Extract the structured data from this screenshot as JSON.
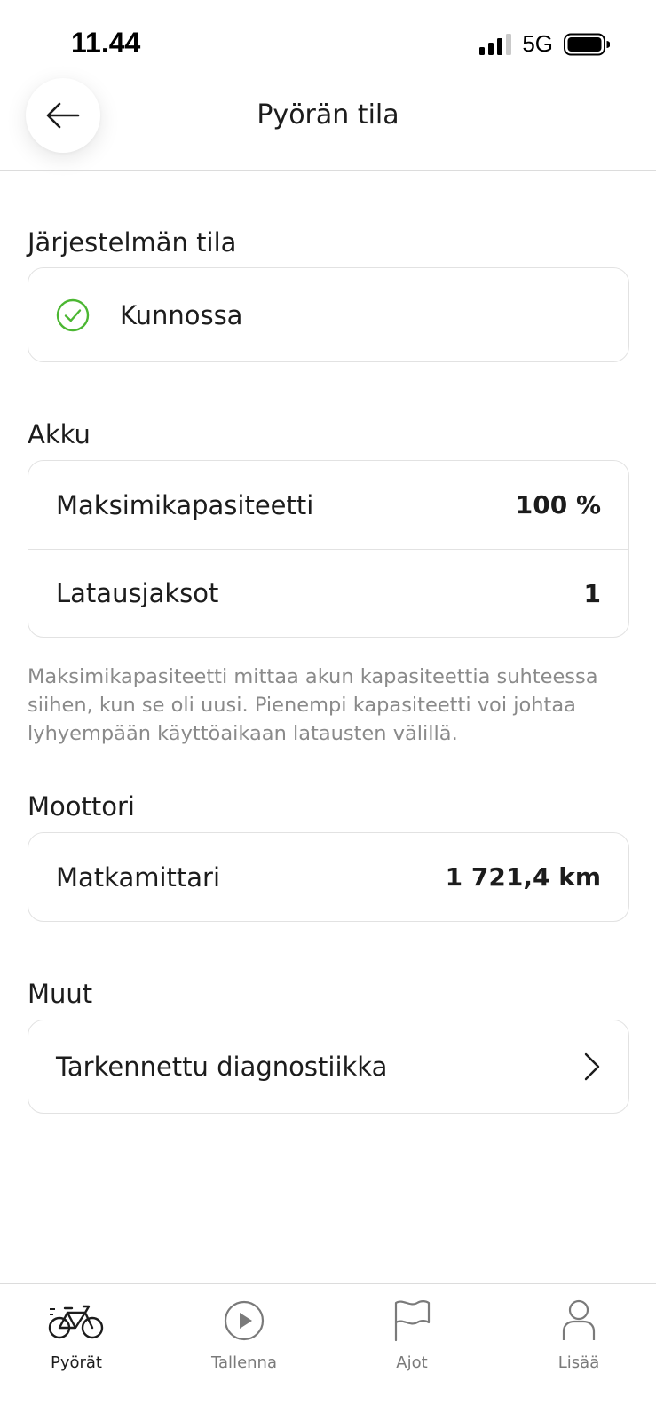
{
  "status_bar": {
    "time": "11.44",
    "network": "5G"
  },
  "header": {
    "title": "Pyörän tila",
    "back_icon": "arrow-left-icon"
  },
  "system_status": {
    "section_title": "Järjestelmän tila",
    "status_text": "Kunnossa",
    "status_color": "#4cb733"
  },
  "battery": {
    "section_title": "Akku",
    "rows": [
      {
        "label": "Maksimikapasiteetti",
        "value": "100 %"
      },
      {
        "label": "Latausjaksot",
        "value": "1"
      }
    ],
    "note": "Maksimikapasiteetti mittaa akun kapasiteettia suhteessa siihen, kun se oli uusi. Pienempi kapasiteetti voi johtaa lyhyempään käyttöaikaan latausten välillä."
  },
  "motor": {
    "section_title": "Moottori",
    "rows": [
      {
        "label": "Matkamittari",
        "value": "1 721,4 km"
      }
    ]
  },
  "other": {
    "section_title": "Muut",
    "rows": [
      {
        "label": "Tarkennettu diagnostiikka"
      }
    ]
  },
  "bottom_nav": {
    "items": [
      {
        "label": "Pyörät",
        "icon": "bike-icon",
        "active": true
      },
      {
        "label": "Tallenna",
        "icon": "play-icon",
        "active": false
      },
      {
        "label": "Ajot",
        "icon": "flag-icon",
        "active": false
      },
      {
        "label": "Lisää",
        "icon": "person-icon",
        "active": false
      }
    ]
  }
}
